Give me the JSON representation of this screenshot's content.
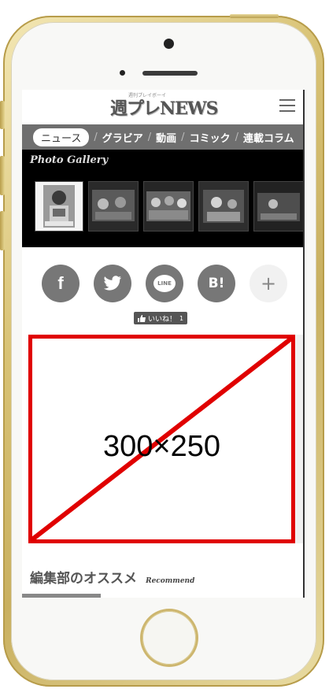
{
  "header": {
    "logo": "週プレNEWS",
    "logo_sub": "週刊プレイボーイ"
  },
  "nav": {
    "items": [
      "ニュース",
      "グラビア",
      "動画",
      "コミック",
      "連載コラム"
    ],
    "separator": "/"
  },
  "gallery": {
    "title": "Photo Gallery"
  },
  "share": {
    "facebook_label": "f",
    "twitter_label": "twitter",
    "line_label": "LINE",
    "hatena_label": "B!",
    "more_label": "+"
  },
  "like": {
    "label": "いいね！",
    "count": "1"
  },
  "ad": {
    "label": "300×250"
  },
  "recommend": {
    "title": "編集部のオススメ",
    "subtitle": "Recommend"
  },
  "colors": {
    "nav_bg": "#6f6f6f",
    "ad_border": "#e00000",
    "share_bg": "#777777",
    "phone_gold": "#d8c275"
  }
}
